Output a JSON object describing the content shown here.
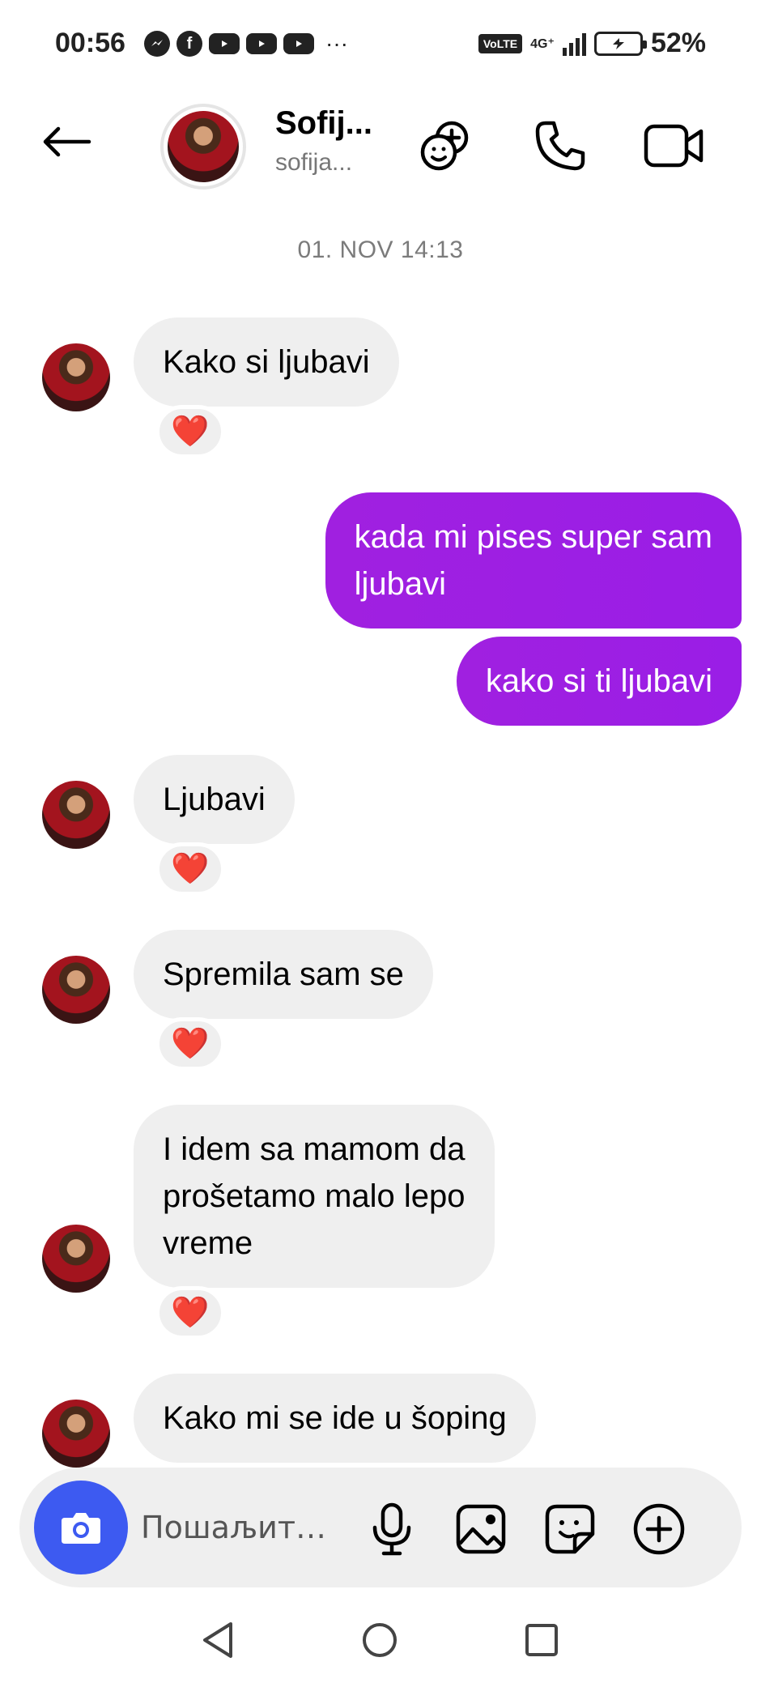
{
  "status_bar": {
    "time": "00:56",
    "apps": [
      {
        "icon": "messenger-icon"
      },
      {
        "icon": "facebook-icon",
        "glyph": "f"
      },
      {
        "icon": "youtube-icon"
      },
      {
        "icon": "youtube-icon"
      },
      {
        "icon": "youtube-icon"
      }
    ],
    "more": "···",
    "volte": "VoLTE",
    "network": "4G⁺",
    "battery_pct": "52%",
    "battery_level": 0.52
  },
  "header": {
    "name": "Sofij...",
    "username": "sofija...",
    "icons": [
      "add-to-group-icon",
      "phone-icon",
      "video-camera-icon"
    ]
  },
  "chat": {
    "timestamp": "01. NOV 14:13",
    "messages": [
      {
        "direction": "incoming",
        "lines": [
          "Kako si ljubavi"
        ],
        "reaction": "❤️"
      },
      {
        "direction": "outgoing",
        "lines": [
          "kada mi pises super sam",
          "ljubavi"
        ]
      },
      {
        "direction": "outgoing",
        "lines": [
          "kako si ti ljubavi"
        ]
      },
      {
        "direction": "incoming",
        "lines": [
          "Ljubavi"
        ],
        "reaction": "❤️"
      },
      {
        "direction": "incoming",
        "lines": [
          "Spremila sam se"
        ],
        "reaction": "❤️"
      },
      {
        "direction": "incoming",
        "lines": [
          "I idem sa mamom da",
          "prošetamo malo lepo",
          "vreme"
        ],
        "reaction": "❤️"
      },
      {
        "direction": "incoming",
        "lines": [
          "Kako mi se ide u šoping"
        ]
      }
    ]
  },
  "composer": {
    "placeholder": "Пошаљит…",
    "accent_color": "#3d5af1"
  },
  "colors": {
    "outgoing_bubble": "#9a1ee6",
    "incoming_bubble": "#efefef"
  }
}
